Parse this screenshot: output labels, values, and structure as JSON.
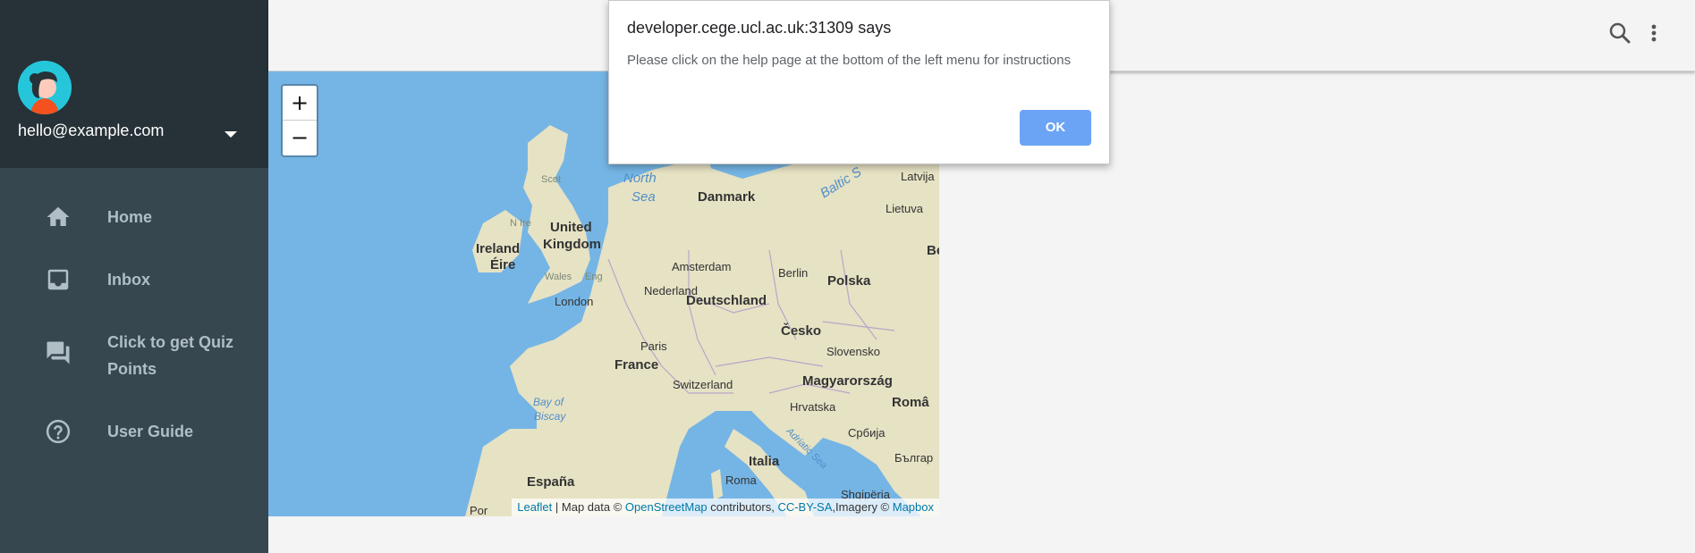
{
  "user": {
    "email": "hello@example.com"
  },
  "nav": {
    "items": [
      {
        "label": "Home",
        "icon": "home-icon"
      },
      {
        "label": "Inbox",
        "icon": "inbox-icon"
      },
      {
        "label_line1": "Click to get Quiz",
        "label_line2": "Points",
        "icon": "forum-icon"
      },
      {
        "label": "User Guide",
        "icon": "help-circle-icon"
      }
    ]
  },
  "header": {
    "search_icon": "search-icon",
    "more_icon": "more-vert-icon"
  },
  "map": {
    "zoom_in": "+",
    "zoom_out": "−",
    "attribution": {
      "leaflet": "Leaflet",
      "sep": " | Map data © ",
      "osm": "OpenStreetMap",
      "contributors": " contributors, ",
      "license": "CC-BY-SA",
      "imagery": ",Imagery © ",
      "mapbox": "Mapbox"
    },
    "labels": {
      "countries": [
        "Danmark",
        "United",
        "Kingdom",
        "Ireland",
        "Éire",
        "Nederland",
        "Deutschland",
        "Polska",
        "Česko",
        "France",
        "Magyarország",
        "España",
        "Italia",
        "Switzerland",
        "Slovensko",
        "Hrvatska",
        "Latvija",
        "Lietuva",
        "Româ",
        "Србија",
        "Българ",
        "Shqipëria",
        "Be",
        "Por"
      ],
      "cities": [
        "Amsterdam",
        "Berlin",
        "London",
        "Paris",
        "Roma"
      ],
      "regions": [
        "Scot",
        "N Ire",
        "Wales",
        "Eng"
      ],
      "seas": [
        "North",
        "Sea",
        "Bay of",
        "Biscay",
        "Baltic S",
        "Adriatic Sea"
      ]
    },
    "colors": {
      "water": "#75b5e5",
      "land": "#e6e2c4"
    }
  },
  "dialog": {
    "title": "developer.cege.ucl.ac.uk:31309 says",
    "message": "Please click on the help page at the bottom of the left menu for instructions",
    "ok_label": "OK"
  },
  "colors": {
    "sidebar": "#37474f",
    "sidebar_header": "#263238",
    "accent": "#6ba4f5",
    "nav_text": "#b0bec5"
  }
}
